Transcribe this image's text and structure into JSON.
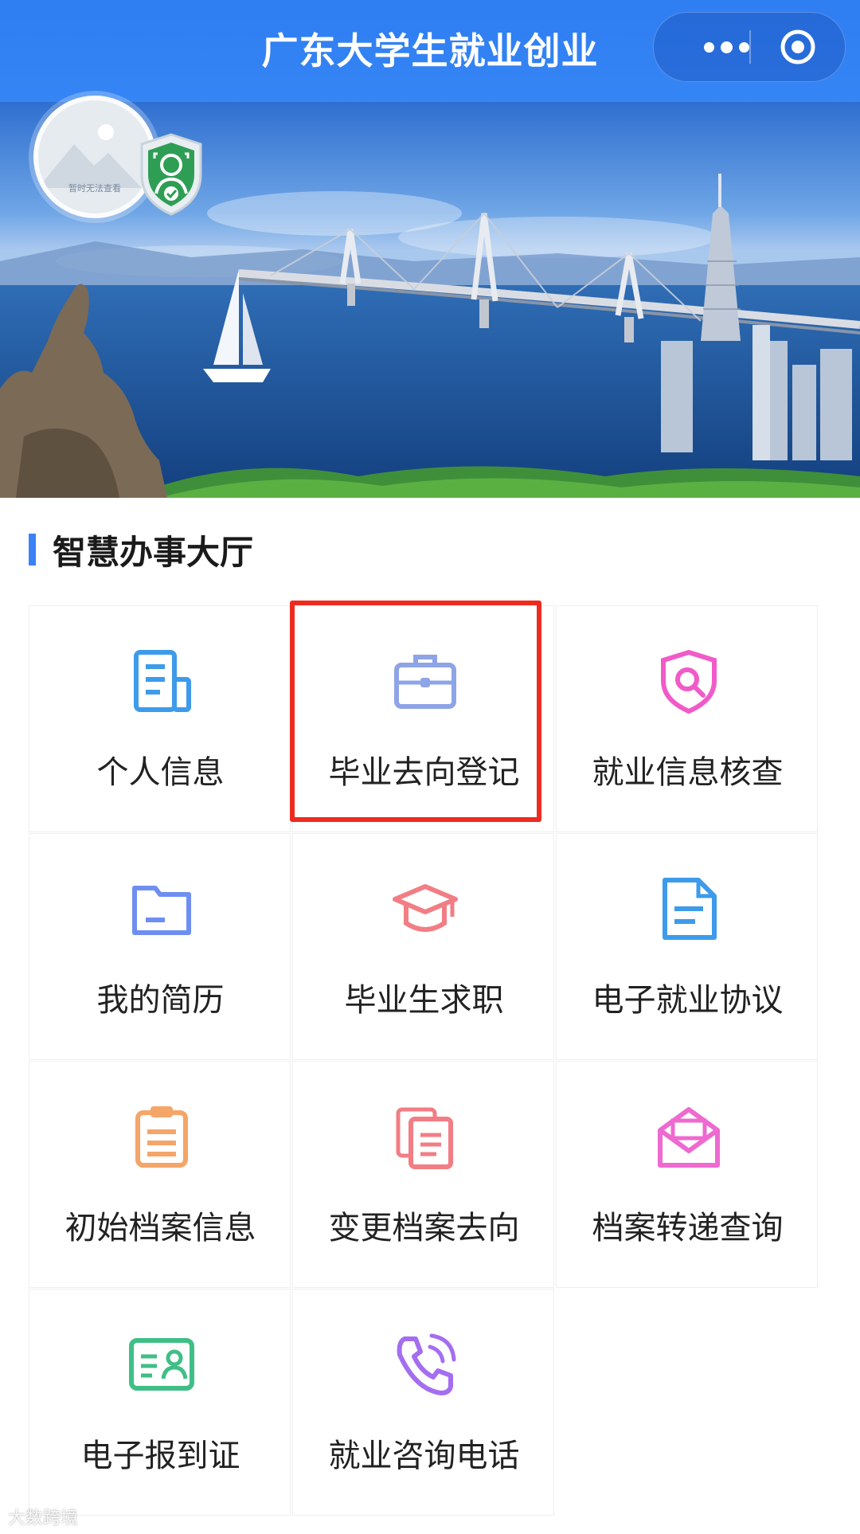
{
  "header": {
    "title": "广东大学生就业创业",
    "more_icon": "more-dots-icon",
    "close_icon": "target-circle-icon"
  },
  "profile": {
    "avatar_caption": "暂时无法查看",
    "badge_icon": "verified-shield-icon"
  },
  "section": {
    "title": "智慧办事大厅"
  },
  "services": [
    {
      "label": "个人信息",
      "icon": "document-icon",
      "color": "#3d9bea"
    },
    {
      "label": "毕业去向登记",
      "icon": "briefcase-icon",
      "color": "#8ea4e6",
      "highlighted": true
    },
    {
      "label": "就业信息核查",
      "icon": "shield-search-icon",
      "color": "#f05bc8"
    },
    {
      "label": "我的简历",
      "icon": "folder-icon",
      "color": "#6e8ef2"
    },
    {
      "label": "毕业生求职",
      "icon": "graduation-cap-icon",
      "color": "#f27d84"
    },
    {
      "label": "电子就业协议",
      "icon": "file-icon",
      "color": "#3d9bea"
    },
    {
      "label": "初始档案信息",
      "icon": "clipboard-icon",
      "color": "#f5a568"
    },
    {
      "label": "变更档案去向",
      "icon": "files-stack-icon",
      "color": "#f27d84"
    },
    {
      "label": "档案转递查询",
      "icon": "mail-open-icon",
      "color": "#ee69d0"
    },
    {
      "label": "电子报到证",
      "icon": "id-card-icon",
      "color": "#3fbf86"
    },
    {
      "label": "就业咨询电话",
      "icon": "phone-call-icon",
      "color": "#a46ef0"
    }
  ],
  "highlight_color": "#ee2b21",
  "watermark": "大数跨境"
}
